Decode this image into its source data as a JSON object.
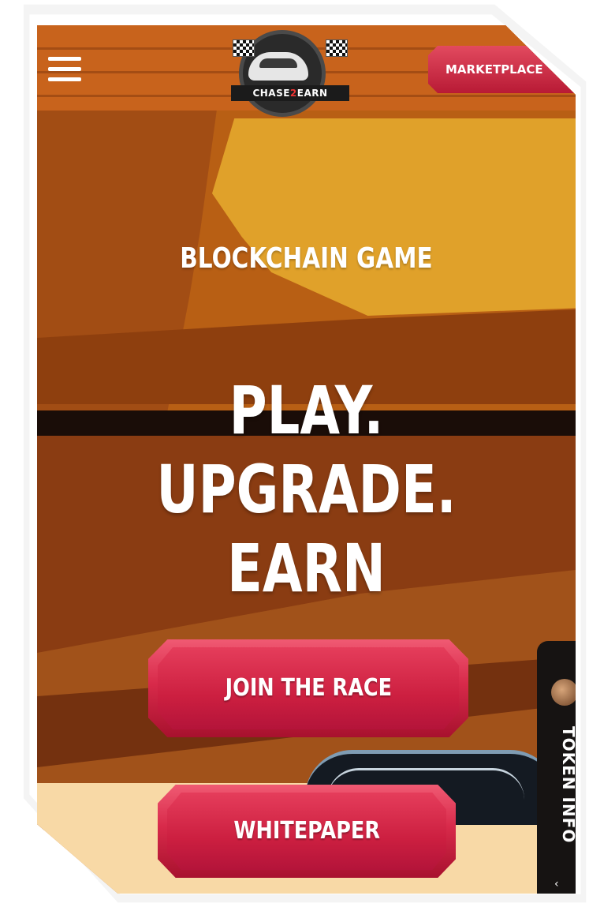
{
  "header": {
    "logo_text_a": "CHASE",
    "logo_text_accent": "2",
    "logo_text_b": "EARN",
    "marketplace_label": "MARKETPLACE"
  },
  "hero": {
    "subtitle": "BLOCKCHAIN GAME",
    "title_line1": "PLAY.",
    "title_line2": "UPGRADE. EARN"
  },
  "cta": {
    "join_label": "JOIN THE RACE",
    "whitepaper_label": "WHITEPAPER"
  },
  "token_tab": {
    "label": "TOKEN INFO",
    "chevron": "‹"
  },
  "colors": {
    "accent_red": "#d82a4a",
    "canyon_orange": "#c26a17",
    "sand": "#f8d9a6"
  },
  "icons": {
    "menu": "hamburger-icon",
    "logo_flags": "checkered-flag-icon",
    "token": "coin-icon"
  }
}
